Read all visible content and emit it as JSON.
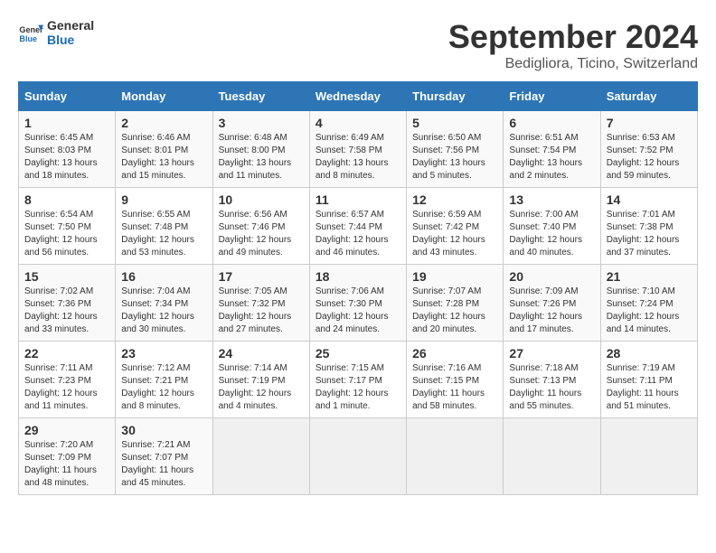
{
  "logo": {
    "general": "General",
    "blue": "Blue"
  },
  "title": "September 2024",
  "subtitle": "Bedigliora, Ticino, Switzerland",
  "days_of_week": [
    "Sunday",
    "Monday",
    "Tuesday",
    "Wednesday",
    "Thursday",
    "Friday",
    "Saturday"
  ],
  "weeks": [
    [
      {
        "day": "1",
        "sunrise": "6:45 AM",
        "sunset": "8:03 PM",
        "daylight": "13 hours and 18 minutes"
      },
      {
        "day": "2",
        "sunrise": "6:46 AM",
        "sunset": "8:01 PM",
        "daylight": "13 hours and 15 minutes"
      },
      {
        "day": "3",
        "sunrise": "6:48 AM",
        "sunset": "8:00 PM",
        "daylight": "13 hours and 11 minutes"
      },
      {
        "day": "4",
        "sunrise": "6:49 AM",
        "sunset": "7:58 PM",
        "daylight": "13 hours and 8 minutes"
      },
      {
        "day": "5",
        "sunrise": "6:50 AM",
        "sunset": "7:56 PM",
        "daylight": "13 hours and 5 minutes"
      },
      {
        "day": "6",
        "sunrise": "6:51 AM",
        "sunset": "7:54 PM",
        "daylight": "13 hours and 2 minutes"
      },
      {
        "day": "7",
        "sunrise": "6:53 AM",
        "sunset": "7:52 PM",
        "daylight": "12 hours and 59 minutes"
      }
    ],
    [
      {
        "day": "8",
        "sunrise": "6:54 AM",
        "sunset": "7:50 PM",
        "daylight": "12 hours and 56 minutes"
      },
      {
        "day": "9",
        "sunrise": "6:55 AM",
        "sunset": "7:48 PM",
        "daylight": "12 hours and 53 minutes"
      },
      {
        "day": "10",
        "sunrise": "6:56 AM",
        "sunset": "7:46 PM",
        "daylight": "12 hours and 49 minutes"
      },
      {
        "day": "11",
        "sunrise": "6:57 AM",
        "sunset": "7:44 PM",
        "daylight": "12 hours and 46 minutes"
      },
      {
        "day": "12",
        "sunrise": "6:59 AM",
        "sunset": "7:42 PM",
        "daylight": "12 hours and 43 minutes"
      },
      {
        "day": "13",
        "sunrise": "7:00 AM",
        "sunset": "7:40 PM",
        "daylight": "12 hours and 40 minutes"
      },
      {
        "day": "14",
        "sunrise": "7:01 AM",
        "sunset": "7:38 PM",
        "daylight": "12 hours and 37 minutes"
      }
    ],
    [
      {
        "day": "15",
        "sunrise": "7:02 AM",
        "sunset": "7:36 PM",
        "daylight": "12 hours and 33 minutes"
      },
      {
        "day": "16",
        "sunrise": "7:04 AM",
        "sunset": "7:34 PM",
        "daylight": "12 hours and 30 minutes"
      },
      {
        "day": "17",
        "sunrise": "7:05 AM",
        "sunset": "7:32 PM",
        "daylight": "12 hours and 27 minutes"
      },
      {
        "day": "18",
        "sunrise": "7:06 AM",
        "sunset": "7:30 PM",
        "daylight": "12 hours and 24 minutes"
      },
      {
        "day": "19",
        "sunrise": "7:07 AM",
        "sunset": "7:28 PM",
        "daylight": "12 hours and 20 minutes"
      },
      {
        "day": "20",
        "sunrise": "7:09 AM",
        "sunset": "7:26 PM",
        "daylight": "12 hours and 17 minutes"
      },
      {
        "day": "21",
        "sunrise": "7:10 AM",
        "sunset": "7:24 PM",
        "daylight": "12 hours and 14 minutes"
      }
    ],
    [
      {
        "day": "22",
        "sunrise": "7:11 AM",
        "sunset": "7:23 PM",
        "daylight": "12 hours and 11 minutes"
      },
      {
        "day": "23",
        "sunrise": "7:12 AM",
        "sunset": "7:21 PM",
        "daylight": "12 hours and 8 minutes"
      },
      {
        "day": "24",
        "sunrise": "7:14 AM",
        "sunset": "7:19 PM",
        "daylight": "12 hours and 4 minutes"
      },
      {
        "day": "25",
        "sunrise": "7:15 AM",
        "sunset": "7:17 PM",
        "daylight": "12 hours and 1 minute"
      },
      {
        "day": "26",
        "sunrise": "7:16 AM",
        "sunset": "7:15 PM",
        "daylight": "11 hours and 58 minutes"
      },
      {
        "day": "27",
        "sunrise": "7:18 AM",
        "sunset": "7:13 PM",
        "daylight": "11 hours and 55 minutes"
      },
      {
        "day": "28",
        "sunrise": "7:19 AM",
        "sunset": "7:11 PM",
        "daylight": "11 hours and 51 minutes"
      }
    ],
    [
      {
        "day": "29",
        "sunrise": "7:20 AM",
        "sunset": "7:09 PM",
        "daylight": "11 hours and 48 minutes"
      },
      {
        "day": "30",
        "sunrise": "7:21 AM",
        "sunset": "7:07 PM",
        "daylight": "11 hours and 45 minutes"
      },
      null,
      null,
      null,
      null,
      null
    ]
  ],
  "labels": {
    "sunrise": "Sunrise:",
    "sunset": "Sunset:",
    "daylight": "Daylight:"
  }
}
